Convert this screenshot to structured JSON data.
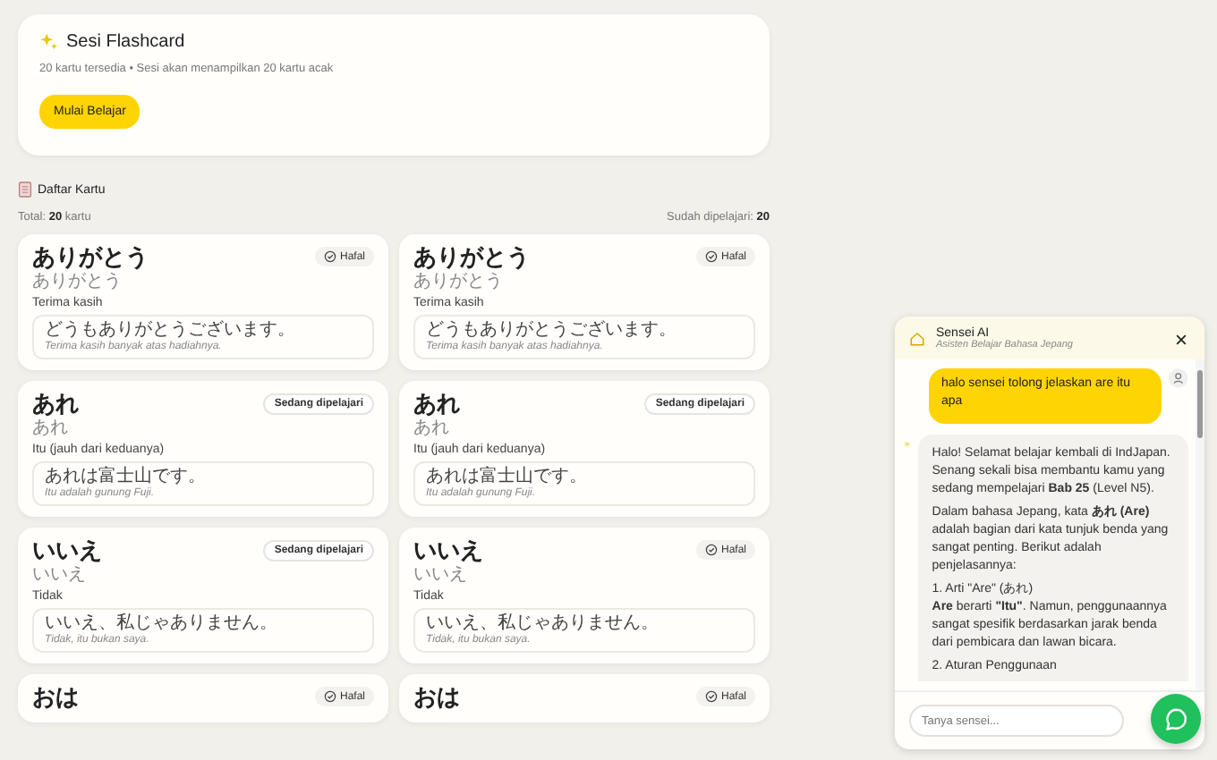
{
  "session": {
    "title": "Sesi Flashcard",
    "subtitle": "20 kartu tersedia • Sesi akan menampilkan 20 kartu acak",
    "button": "Mulai Belajar"
  },
  "list": {
    "title": "Daftar Kartu",
    "total": "Total: **20** kartu",
    "learned": "Sudah dipelajari: **20**"
  },
  "cards": [
    {
      "word": "ありがとう",
      "reading": "ありがとう",
      "meaning": "Terima kasih",
      "example": "どうもありがとうございます。",
      "translation": "Terima kasih banyak atas hadiahnya.",
      "status": {
        "label": "Hafal",
        "kind": "memorized"
      }
    },
    {
      "word": "ありがとう",
      "reading": "ありがとう",
      "meaning": "Terima kasih",
      "example": "どうもありがとうございます。",
      "translation": "Terima kasih banyak atas hadiahnya.",
      "status": {
        "label": "Hafal",
        "kind": "memorized"
      }
    },
    {
      "word": "あれ",
      "reading": "あれ",
      "meaning": "Itu (jauh dari keduanya)",
      "example": "あれは富士山です。",
      "translation": "Itu adalah gunung Fuji.",
      "status": {
        "label": "Sedang dipelajari",
        "kind": "learning"
      }
    },
    {
      "word": "あれ",
      "reading": "あれ",
      "meaning": "Itu (jauh dari keduanya)",
      "example": "あれは富士山です。",
      "translation": "Itu adalah gunung Fuji.",
      "status": {
        "label": "Sedang dipelajari",
        "kind": "learning"
      }
    },
    {
      "word": "いいえ",
      "reading": "いいえ",
      "meaning": "Tidak",
      "example": "いいえ、私じゃありません。",
      "translation": "Tidak, itu bukan saya.",
      "status": {
        "label": "Sedang dipelajari",
        "kind": "learning"
      }
    },
    {
      "word": "いいえ",
      "reading": "いいえ",
      "meaning": "Tidak",
      "example": "いいえ、私じゃありません。",
      "translation": "Tidak, itu bukan saya.",
      "status": {
        "label": "Hafal",
        "kind": "memorized"
      }
    },
    {
      "word": "おは",
      "status": {
        "label": "Hafal",
        "kind": "memorized"
      }
    },
    {
      "word": "おは",
      "status": {
        "label": "Hafal",
        "kind": "memorized"
      }
    }
  ],
  "chat": {
    "title": "Sensei AI",
    "subtitle": "Asisten Belajar Bahasa Jepang",
    "placeholder": "Tanya sensei...",
    "messages": [
      {
        "kind": "user",
        "paragraphs": [
          "halo sensei tolong jelaskan are itu apa"
        ]
      },
      {
        "kind": "bot",
        "paragraphs": [
          "Halo! Selamat belajar kembali di IndJapan. Senang sekali bisa membantu kamu yang sedang mempelajari **Bab 25** (Level N5).",
          "Dalam bahasa Jepang, kata **あれ (Are)** adalah bagian dari kata tunjuk benda yang sangat penting. Berikut adalah penjelasannya:",
          "1. Arti \"Are\" (あれ)\n**Are** berarti **\"Itu\"**. Namun, penggunaannya sangat spesifik berdasarkan jarak benda dari pembicara dan lawan bicara.",
          "2. Aturan Penggunaan"
        ]
      }
    ]
  }
}
